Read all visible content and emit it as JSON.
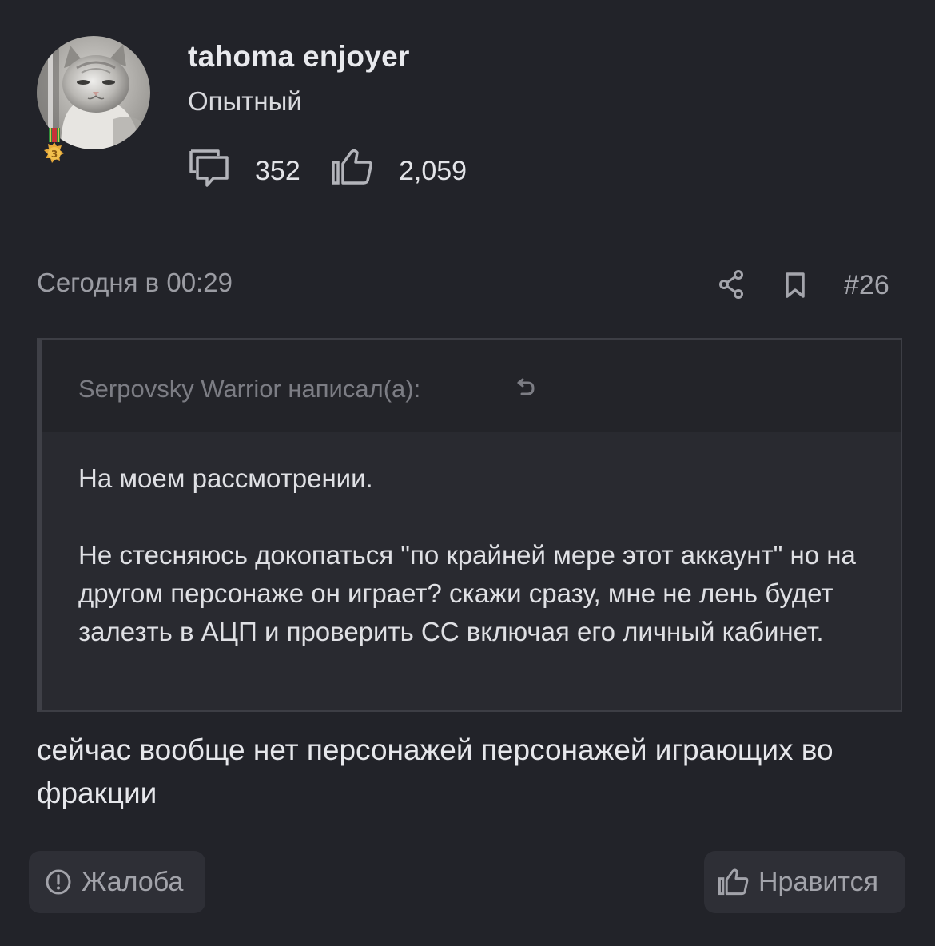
{
  "user": {
    "name": "tahoma enjoyer",
    "rank": "Опытный",
    "medal_level": "3",
    "messages_count": "352",
    "reactions_count": "2,059"
  },
  "post": {
    "date": "Сегодня в 00:29",
    "number": "#26"
  },
  "quote": {
    "author": "Serpovsky Warrior написал(а):",
    "paragraphs": [
      "На моем рассмотрении.",
      "Не стесняюсь докопаться \"по крайней мере этот аккаунт\" но на другом персонаже он играет? скажи сразу, мне не лень будет залезть в АЦП и проверить СС включая его личный кабинет."
    ]
  },
  "message": "сейчас вообще нет персонажей персонажей играющих во фракции",
  "actions": {
    "report_label": "Жалоба",
    "like_label": "Нравится"
  },
  "icons": {
    "messages": "speech-bubbles-icon",
    "reactions": "thumbs-up-icon",
    "share": "share-icon",
    "bookmark": "bookmark-icon",
    "quote_jump": "jump-to-quote-icon",
    "report": "exclamation-circle-icon",
    "medal": "medal-icon"
  }
}
